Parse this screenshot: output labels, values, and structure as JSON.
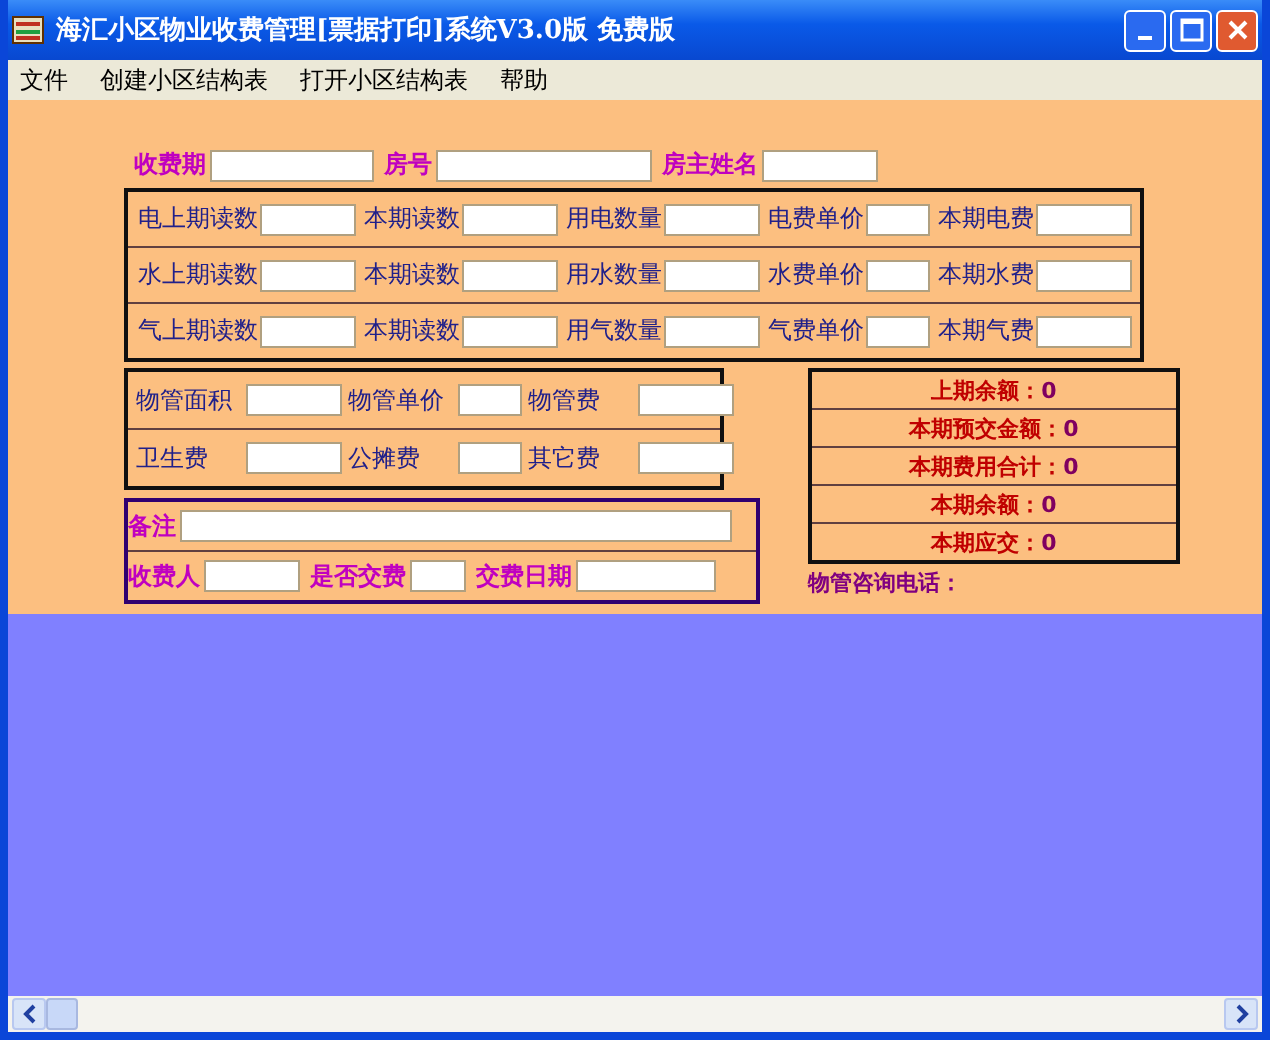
{
  "window": {
    "title": "海汇小区物业收费管理[票据打印]系统V3.0版 免费版"
  },
  "menu": {
    "items": [
      "文件",
      "创建小区结构表",
      "打开小区结构表",
      "帮助"
    ]
  },
  "header_fields": [
    {
      "label": "收费期"
    },
    {
      "label": "房号"
    },
    {
      "label": "房主姓名"
    }
  ],
  "meters": {
    "rows": [
      {
        "cells": [
          "电上期读数",
          "本期读数",
          "用电数量",
          "电费单价",
          "本期电费"
        ]
      },
      {
        "cells": [
          "水上期读数",
          "本期读数",
          "用水数量",
          "水费单价",
          "本期水费"
        ]
      },
      {
        "cells": [
          "气上期读数",
          "本期读数",
          "用气数量",
          "气费单价",
          "本期气费"
        ]
      }
    ]
  },
  "property_fees": {
    "rows": [
      {
        "cells": [
          "物管面积",
          "物管单价",
          "物管费"
        ]
      },
      {
        "cells": [
          "卫生费",
          "公摊费",
          "其它费"
        ]
      }
    ]
  },
  "remarks": {
    "label": "备注"
  },
  "payment": [
    {
      "label": "收费人"
    },
    {
      "label": "是否交费"
    },
    {
      "label": "交费日期"
    }
  ],
  "balances": [
    {
      "label": "上期余额：",
      "value": "0"
    },
    {
      "label": "本期预交金额：",
      "value": "0"
    },
    {
      "label": "本期费用合计：",
      "value": "0"
    },
    {
      "label": "本期余额：",
      "value": "0"
    },
    {
      "label": "本期应交：",
      "value": "0"
    }
  ],
  "phone_label": "物管咨询电话："
}
